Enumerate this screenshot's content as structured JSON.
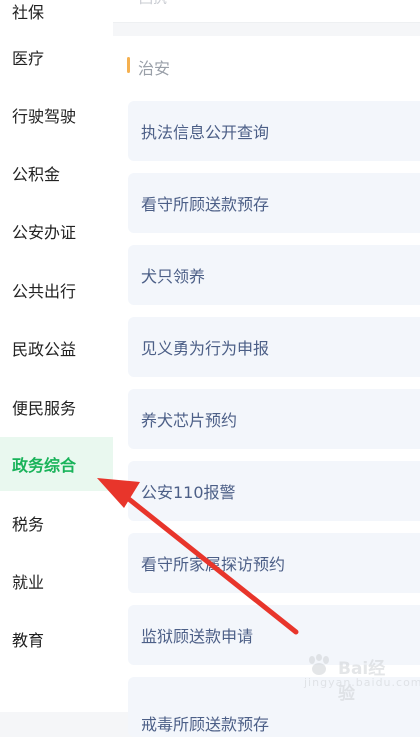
{
  "sidebar": {
    "items": [
      {
        "label": "社保",
        "active": false
      },
      {
        "label": "医疗",
        "active": false
      },
      {
        "label": "行驶驾驶",
        "active": false
      },
      {
        "label": "公积金",
        "active": false
      },
      {
        "label": "公安办证",
        "active": false
      },
      {
        "label": "公共出行",
        "active": false
      },
      {
        "label": "民政公益",
        "active": false
      },
      {
        "label": "便民服务",
        "active": false
      },
      {
        "label": "政务综合",
        "active": true
      },
      {
        "label": "税务",
        "active": false
      },
      {
        "label": "就业",
        "active": false
      },
      {
        "label": "教育",
        "active": false
      }
    ],
    "active_color": "#19b35a",
    "active_bg": "#e9f8ef"
  },
  "top_card": {
    "text": "回执"
  },
  "section": {
    "title": "治安",
    "accent_color": "#f5b04f",
    "services": [
      {
        "label": "执法信息公开查询"
      },
      {
        "label": "看守所顾送款预存"
      },
      {
        "label": "犬只领养"
      },
      {
        "label": "见义勇为行为申报"
      },
      {
        "label": "养犬芯片预约"
      },
      {
        "label": "公安110报警"
      },
      {
        "label": "看守所家属探访预约"
      },
      {
        "label": "监狱顾送款申请"
      },
      {
        "label": "戒毒所顾送款预存"
      }
    ]
  },
  "annotation": {
    "color": "#e8352b"
  },
  "watermark": {
    "brand": "Bai经验",
    "domain": "jingyan.baidu.com"
  }
}
